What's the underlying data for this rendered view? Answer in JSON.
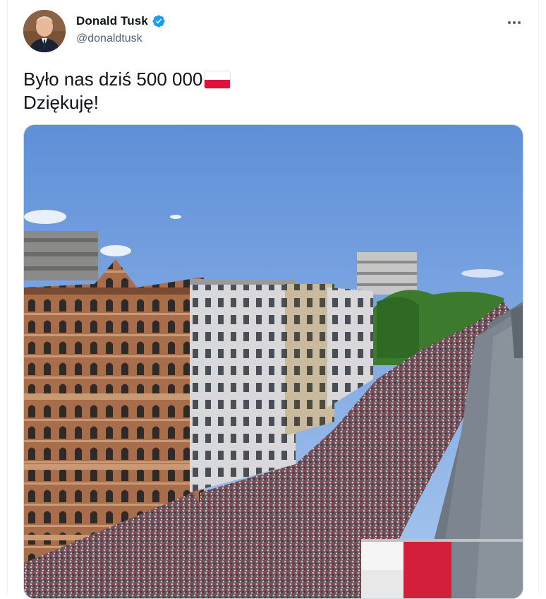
{
  "tweet": {
    "author_name": "Donald Tusk",
    "author_handle": "@donaldtusk",
    "verified": true,
    "text_line1": "Było nas dziś 500 000",
    "text_line2": "Dziękuję!",
    "flag_emoji": "poland-flag-icon"
  },
  "icons": {
    "verified": "verified-badge-icon",
    "more": "more-options-icon"
  },
  "colors": {
    "verified_blue": "#1d9bf0",
    "text_primary": "#0f1419",
    "text_secondary": "#536471",
    "flag_red": "#dc143c"
  },
  "media": {
    "type": "photo",
    "subject": "aerial-crowd-street"
  }
}
